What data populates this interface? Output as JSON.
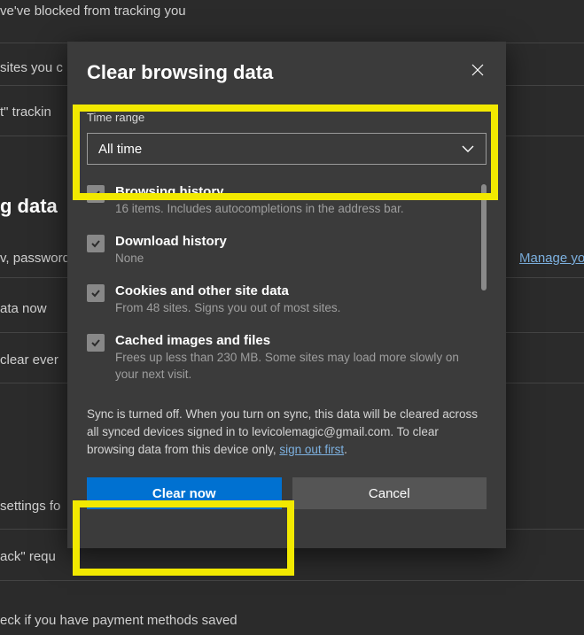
{
  "background": {
    "line1": "ve've blocked from tracking you",
    "line2": "sites you c",
    "line3": "t\" trackin",
    "heading": "g data",
    "line4": "v, password",
    "line5": "ata now",
    "line6": "clear ever",
    "line7": "settings fo",
    "line8": "ack\" requ",
    "line9": "eck if you have payment methods saved",
    "manage": "Manage yo"
  },
  "dialog": {
    "title": "Clear browsing data",
    "time_range_label": "Time range",
    "time_range_value": "All time",
    "items": [
      {
        "title": "Browsing history",
        "desc": "16 items. Includes autocompletions in the address bar."
      },
      {
        "title": "Download history",
        "desc": "None"
      },
      {
        "title": "Cookies and other site data",
        "desc": "From 48 sites. Signs you out of most sites."
      },
      {
        "title": "Cached images and files",
        "desc": "Frees up less than 230 MB. Some sites may load more slowly on your next visit."
      }
    ],
    "sync_msg_part1": "Sync is turned off. When you turn on sync, this data will be cleared across all synced devices signed in to levicolemagic@gmail.com. To clear browsing data from this device only, ",
    "sync_link": "sign out first",
    "sync_msg_part2": ".",
    "clear_label": "Clear now",
    "cancel_label": "Cancel"
  }
}
